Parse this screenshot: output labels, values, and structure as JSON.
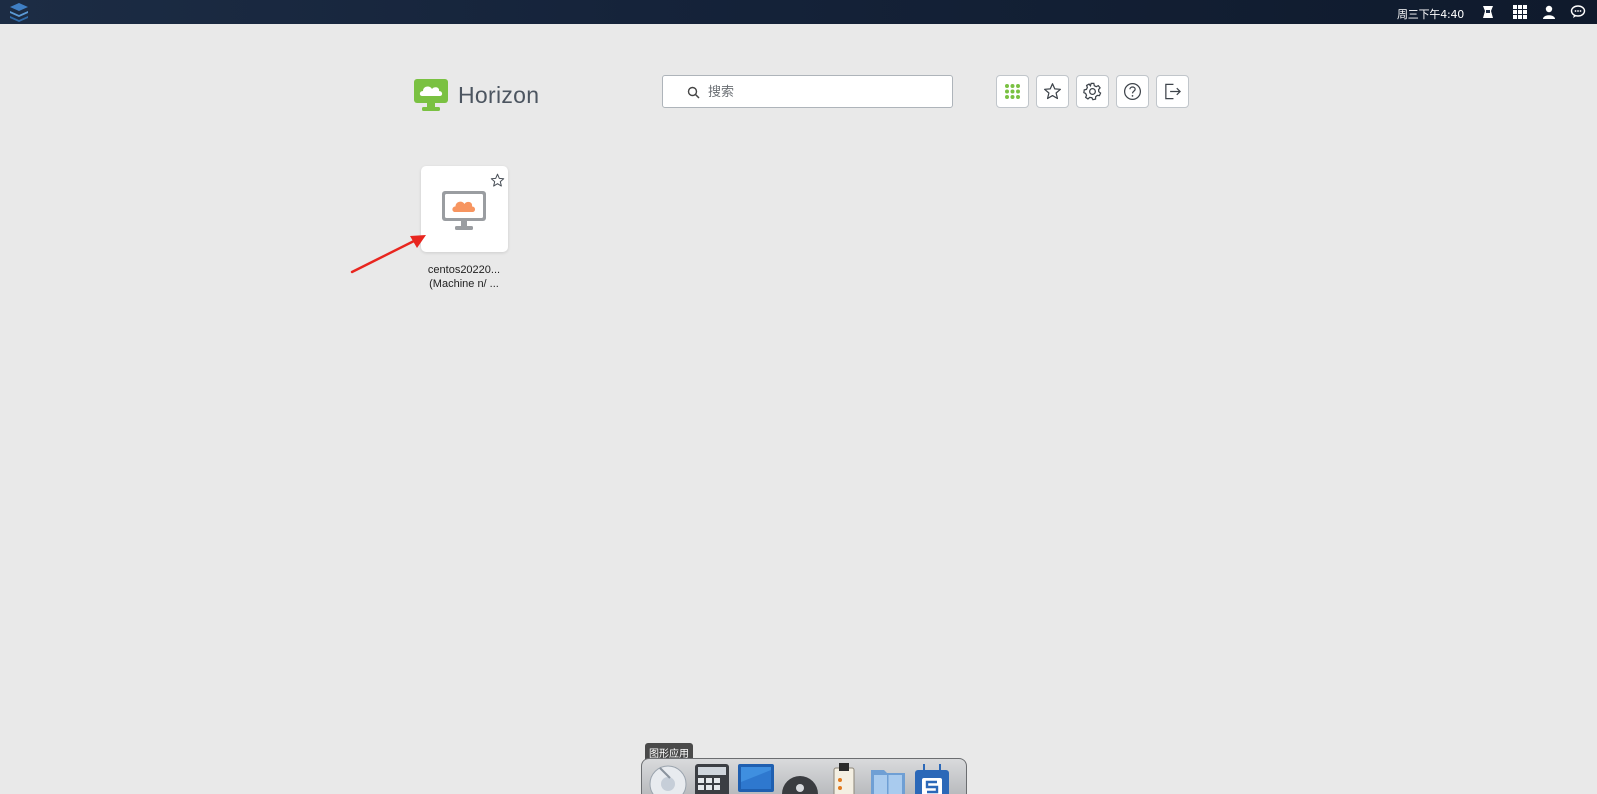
{
  "topbar": {
    "clock": "周三下午4:40",
    "icons": [
      "os-logo-icon",
      "tray-app-icon",
      "app-grid-icon",
      "user-icon",
      "chat-icon"
    ]
  },
  "horizon": {
    "brand": "Horizon",
    "brand_color": "#7ac142",
    "search_placeholder": "搜索",
    "toolbar": [
      "apps-grid-icon",
      "favorites-star-icon",
      "settings-gear-icon",
      "help-icon",
      "logout-icon"
    ]
  },
  "desktops": [
    {
      "name_line1": "centos20220...",
      "name_line2": "(Machine n/ ...",
      "icon": "desktop-monitor-cloud-icon",
      "favorite": false
    }
  ],
  "annotation": {
    "arrow_color": "#e8261f"
  },
  "dock": {
    "tooltip": "图形应用",
    "apps": [
      "disk-utility-icon",
      "calculator-icon",
      "monitor-app-icon",
      "lock-app-icon",
      "notes-app-icon",
      "files-app-icon",
      "store-app-icon"
    ]
  }
}
